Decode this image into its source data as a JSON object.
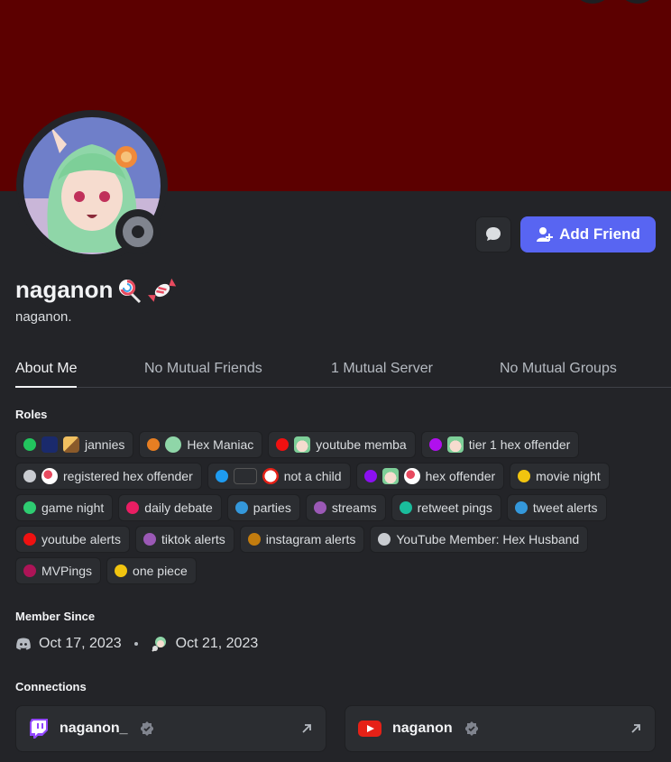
{
  "colors": {
    "banner": "#5c0000",
    "accent": "#5865f2",
    "bg": "#232428",
    "chip": "#2b2d31"
  },
  "profile": {
    "display_name": "naganon",
    "name_emojis": [
      "lollipop-icon",
      "candy-icon"
    ],
    "username": "naganon.",
    "status": "offline"
  },
  "actions": {
    "message_icon": "chat-bubble-icon",
    "add_friend": "Add Friend"
  },
  "tabs": [
    {
      "label": "About Me",
      "active": true
    },
    {
      "label": "No Mutual Friends",
      "active": false
    },
    {
      "label": "1 Mutual Server",
      "active": false
    },
    {
      "label": "No Mutual Groups",
      "active": false
    }
  ],
  "roles_heading": "Roles",
  "roles": [
    [
      {
        "label": "jannies",
        "color": "#22c55e",
        "icons": [
          "ftm-sign-icon",
          "broom-icon"
        ]
      },
      {
        "label": "Hex Maniac",
        "color": "#e67e22",
        "icons": [
          "chibi-icon"
        ]
      },
      {
        "label": "youtube memba",
        "color": "#ef1111",
        "icons": [
          "chibi-face-icon"
        ]
      },
      {
        "label": "tier 1 hex offender",
        "color": "#b010ee",
        "icons": [
          "chibi-face-icon"
        ]
      }
    ],
    [
      {
        "label": "registered hex offender",
        "color": "#c9ccd1",
        "icons": [
          "lollipop-icon"
        ]
      },
      {
        "label": "not a child",
        "color": "#1e9bf0",
        "icons": [
          "horny-sign-icon",
          "18-icon"
        ]
      },
      {
        "label": "hex offender",
        "color": "#8b10f0",
        "icons": [
          "chibi-face-icon",
          "lollipop-icon"
        ]
      },
      {
        "label": "movie night",
        "color": "#f1c40f",
        "icons": []
      }
    ],
    [
      {
        "label": "game night",
        "color": "#2ecc71",
        "icons": []
      },
      {
        "label": "daily debate",
        "color": "#e91e63",
        "icons": []
      },
      {
        "label": "parties",
        "color": "#3498db",
        "icons": []
      },
      {
        "label": "streams",
        "color": "#9b59b6",
        "icons": []
      },
      {
        "label": "retweet pings",
        "color": "#1abc9c",
        "icons": []
      },
      {
        "label": "tweet alerts",
        "color": "#3498db",
        "icons": []
      }
    ],
    [
      {
        "label": "youtube alerts",
        "color": "#ef1111",
        "icons": []
      },
      {
        "label": "tiktok alerts",
        "color": "#9b59b6",
        "icons": []
      },
      {
        "label": "instagram alerts",
        "color": "#c27c0e",
        "icons": []
      },
      {
        "label": "YouTube Member: Hex Husband",
        "color": "#c9ccd1",
        "icons": []
      }
    ],
    [
      {
        "label": "MVPings",
        "color": "#ad1457",
        "icons": []
      },
      {
        "label": "one piece",
        "color": "#f1c40f",
        "icons": []
      }
    ]
  ],
  "member_since": {
    "heading": "Member Since",
    "discord_icon": "discord-icon",
    "discord_date": "Oct 17, 2023",
    "server_icon": "server-icon",
    "server_date": "Oct 21, 2023"
  },
  "connections": {
    "heading": "Connections",
    "items": [
      {
        "platform": "twitch",
        "icon": "twitch-icon",
        "name": "naganon_",
        "verified": true
      },
      {
        "platform": "youtube",
        "icon": "youtube-icon",
        "name": "naganon",
        "verified": true
      }
    ]
  }
}
